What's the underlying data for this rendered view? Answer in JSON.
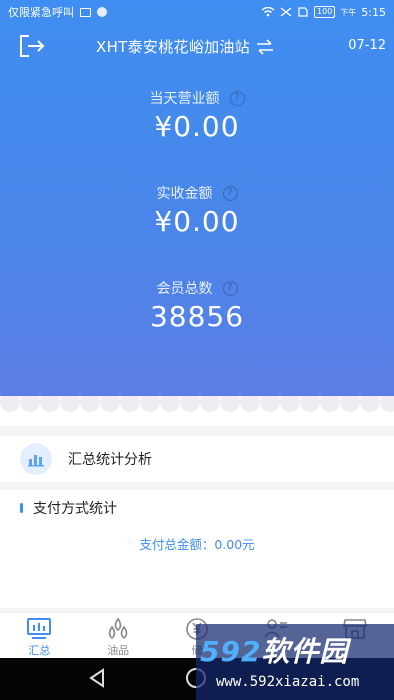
{
  "status_bar": {
    "emergency_text": "仅限紧急呼叫",
    "battery": "100",
    "time_prefix": "下午",
    "time": "5:15"
  },
  "header": {
    "station_name": "XHT泰安桃花峪加油站",
    "date": "07-12"
  },
  "metrics": [
    {
      "label": "当天营业额",
      "value": "¥0.00"
    },
    {
      "label": "实收金额",
      "value": "¥0.00"
    },
    {
      "label": "会员总数",
      "value": "38856"
    }
  ],
  "summary": {
    "title": "汇总统计分析"
  },
  "payment": {
    "title": "支付方式统计",
    "total_text": "支付总金额：0.00元"
  },
  "tabs": [
    {
      "label": "汇总",
      "icon": "monitor-icon",
      "active": true
    },
    {
      "label": "油品",
      "icon": "oil-drops-icon",
      "active": false
    },
    {
      "label": "储",
      "icon": "yen-circle-icon",
      "active": false
    },
    {
      "label": "",
      "icon": "member-card-icon",
      "active": false
    },
    {
      "label": "",
      "icon": "store-icon",
      "active": false
    }
  ],
  "watermark": {
    "logo_number": "592",
    "logo_text": "软件园",
    "url": "www.592xiazai.com"
  },
  "colors": {
    "accent": "#3f8ef1",
    "hero_top": "#3f8ef1",
    "hero_bottom": "#5b7ee6"
  }
}
